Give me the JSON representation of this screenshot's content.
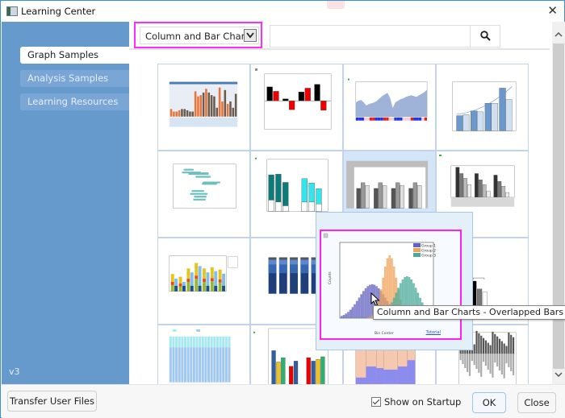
{
  "window": {
    "title": "Learning Center",
    "close_icon": "close-icon",
    "app_icon": "learning-center-icon"
  },
  "sidebar": {
    "items": [
      {
        "label": "Graph Samples",
        "active": true
      },
      {
        "label": "Analysis Samples",
        "active": false
      },
      {
        "label": "Learning Resources",
        "active": false
      }
    ],
    "version": "v3"
  },
  "toolbar": {
    "category_selected": "Column and Bar Charts",
    "search_value": "",
    "search_placeholder": "",
    "search_icon": "search-icon",
    "dropdown_icon": "chevron-down-icon"
  },
  "gallery": {
    "thumbnails": [
      {
        "kind": "grouped-bars-table",
        "colors": [
          "#e8743b",
          "#6b5d4d"
        ]
      },
      {
        "kind": "pos-neg-bars",
        "colors": [
          "#000000",
          "#ee0000"
        ]
      },
      {
        "kind": "area-with-heatstrip",
        "colors": [
          "#9fb3d9",
          "#dd2222",
          "#2233dd"
        ]
      },
      {
        "kind": "bars-with-trend",
        "colors": [
          "#6a98cc",
          "#d0e0f0"
        ]
      },
      {
        "kind": "floating-bars",
        "colors": [
          "#6abfbf"
        ]
      },
      {
        "kind": "stacked-teal-cyan",
        "colors": [
          "#0e7b7b",
          "#33e6ee"
        ]
      },
      {
        "kind": "grey-grouped-error",
        "colors": [
          "#555555",
          "#999999",
          "#dddddd"
        ]
      },
      {
        "kind": "grey-bars-table",
        "colors": [
          "#333333",
          "#777777",
          "#bbbbbb"
        ]
      },
      {
        "kind": "stacked-multicolor",
        "colors": [
          "#e8c41a",
          "#e84b1a",
          "#9ab82a",
          "#1f4e8c",
          "#7fbfef"
        ]
      },
      {
        "kind": "stacked-100-blue",
        "colors": [
          "#1f3f7a",
          "#3568b0",
          "#5c88cc"
        ]
      },
      {
        "kind": "overlapped-hist",
        "colors": [
          "#6262c0",
          "#f0a35a",
          "#4aaa9a"
        ]
      },
      {
        "kind": "bars-with-brackets",
        "colors": [
          "#000000",
          "#777777",
          "#ffffff"
        ]
      },
      {
        "kind": "pos-neg-cyan",
        "colors": [
          "#a8e8f0",
          "#a0c8f0"
        ]
      },
      {
        "kind": "grouped-four",
        "colors": [
          "#ee0000",
          "#2f5f9f",
          "#f0c020",
          "#30b070"
        ]
      },
      {
        "kind": "stacked-area-bars",
        "colors": [
          "#f7c8b0",
          "#8c8cf0"
        ]
      },
      {
        "kind": "grey-pos-neg",
        "colors": [
          "#555555",
          "#aaaaaa"
        ]
      }
    ]
  },
  "popup": {
    "legend": [
      "Group 1",
      "Group 2",
      "Group 3"
    ],
    "xlabel": "Bin Center",
    "ylabel": "Counts",
    "link_label": "Tutorial"
  },
  "tooltip": {
    "text": "Column and Bar Charts - Overlapped Bars"
  },
  "footer": {
    "transfer_label": "Transfer User Files",
    "show_on_startup_label": "Show on Startup",
    "show_on_startup_checked": true,
    "ok_label": "OK",
    "close_label": "Close"
  },
  "colors": {
    "sidebar_bg": "#6699cc",
    "highlight_frame": "#ff22ee",
    "window_border": "#3b8ed8"
  }
}
